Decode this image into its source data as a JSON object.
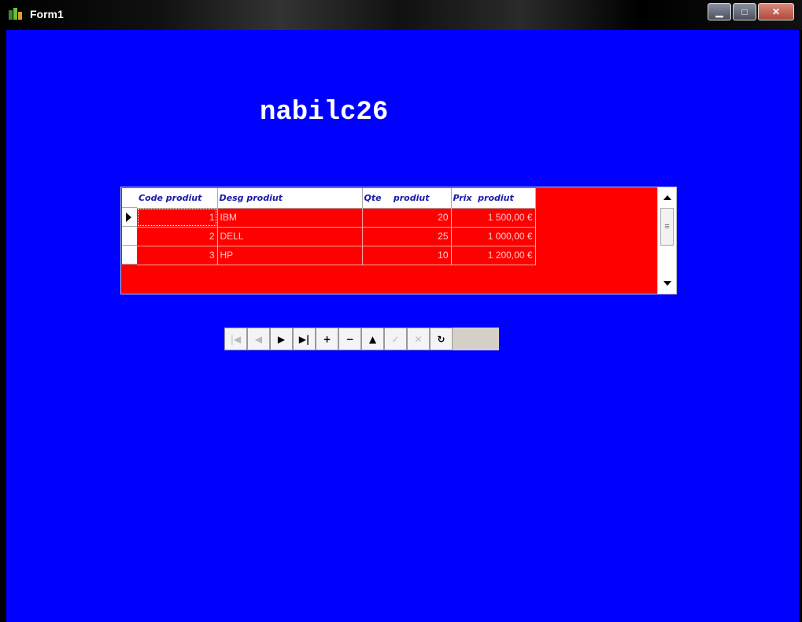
{
  "window": {
    "title": "Form1"
  },
  "main": {
    "heading": "nabilc26"
  },
  "grid": {
    "columns": [
      "Code prodiut",
      "Desg prodiut",
      "Qte    prodiut",
      "Prix  prodiut"
    ],
    "rows": [
      {
        "code": "1",
        "desg": "IBM",
        "qte": "20",
        "prix": "1 500,00 €"
      },
      {
        "code": "2",
        "desg": "DELL",
        "qte": "25",
        "prix": "1 000,00 €"
      },
      {
        "code": "3",
        "desg": "HP",
        "qte": "10",
        "prix": "1 200,00 €"
      }
    ]
  },
  "navigator": {
    "buttons": [
      {
        "name": "first",
        "glyph": "|◀",
        "enabled": false
      },
      {
        "name": "prior",
        "glyph": "◀",
        "enabled": false
      },
      {
        "name": "next",
        "glyph": "▶",
        "enabled": true
      },
      {
        "name": "last",
        "glyph": "▶|",
        "enabled": true
      },
      {
        "name": "insert",
        "glyph": "+",
        "enabled": true
      },
      {
        "name": "delete",
        "glyph": "−",
        "enabled": true
      },
      {
        "name": "edit",
        "glyph": "▲",
        "enabled": true
      },
      {
        "name": "post",
        "glyph": "✓",
        "enabled": false
      },
      {
        "name": "cancel",
        "glyph": "✕",
        "enabled": false
      },
      {
        "name": "refresh",
        "glyph": "↻",
        "enabled": true
      }
    ]
  },
  "colors": {
    "form_bg": "#0000ff",
    "grid_bg": "#ff0000",
    "header_text": "#1a1aa8"
  }
}
